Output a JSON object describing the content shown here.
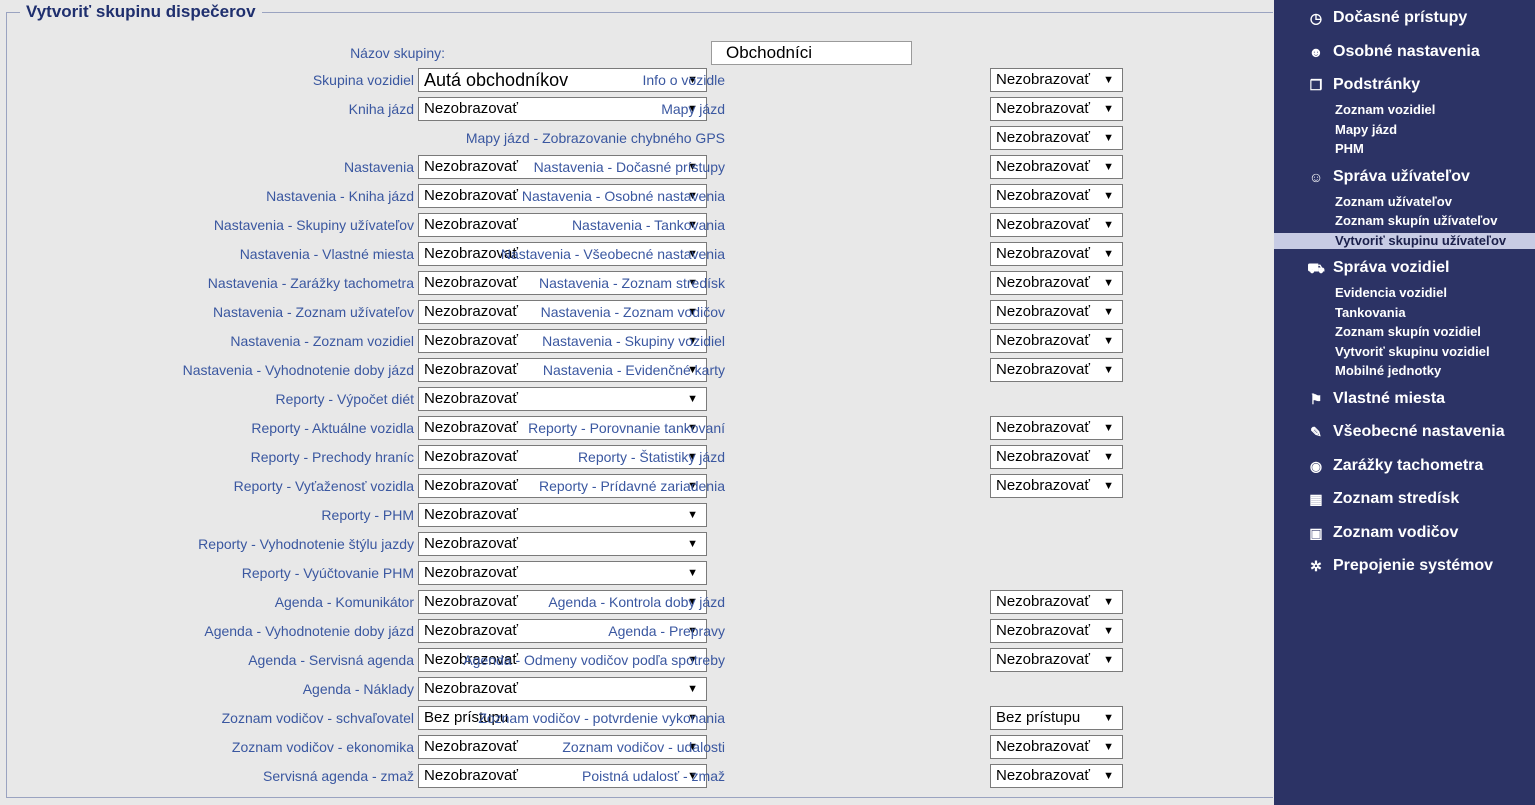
{
  "form": {
    "legend": "Vytvoriť skupinu dispečerov",
    "name_label": "Názov skupiny:",
    "name_value": "Obchodníci"
  },
  "rows_left": [
    {
      "label": "Skupina vozidiel",
      "value": "Autá obchodníkov"
    },
    {
      "label": "Kniha jázd",
      "value": "Nezobrazovať"
    },
    null,
    {
      "label": "Nastavenia",
      "value": "Nezobrazovať"
    },
    {
      "label": "Nastavenia - Kniha jázd",
      "value": "Nezobrazovať"
    },
    {
      "label": "Nastavenia - Skupiny užívateľov",
      "value": "Nezobrazovať"
    },
    {
      "label": "Nastavenia - Vlastné miesta",
      "value": "Nezobrazovať"
    },
    {
      "label": "Nastavenia - Zarážky tachometra",
      "value": "Nezobrazovať"
    },
    {
      "label": "Nastavenia - Zoznam užívateľov",
      "value": "Nezobrazovať"
    },
    {
      "label": "Nastavenia - Zoznam vozidiel",
      "value": "Nezobrazovať"
    },
    {
      "label": "Nastavenia - Vyhodnotenie doby jázd",
      "value": "Nezobrazovať"
    },
    {
      "label": "Reporty - Výpočet diét",
      "value": "Nezobrazovať"
    },
    {
      "label": "Reporty - Aktuálne vozidla",
      "value": "Nezobrazovať"
    },
    {
      "label": "Reporty - Prechody hraníc",
      "value": "Nezobrazovať"
    },
    {
      "label": "Reporty - Vyťaženosť vozidla",
      "value": "Nezobrazovať"
    },
    {
      "label": "Reporty - PHM",
      "value": "Nezobrazovať"
    },
    {
      "label": "Reporty - Vyhodnotenie štýlu jazdy",
      "value": "Nezobrazovať"
    },
    {
      "label": "Reporty - Vyúčtovanie PHM",
      "value": "Nezobrazovať"
    },
    {
      "label": "Agenda - Komunikátor",
      "value": "Nezobrazovať"
    },
    {
      "label": "Agenda - Vyhodnotenie doby jázd",
      "value": "Nezobrazovať"
    },
    {
      "label": "Agenda - Servisná agenda",
      "value": "Nezobrazovať"
    },
    {
      "label": "Agenda - Náklady",
      "value": "Nezobrazovať"
    },
    {
      "label": "Zoznam vodičov - schvaľovatel",
      "value": "Bez prístupu"
    },
    {
      "label": "Zoznam vodičov - ekonomika",
      "value": "Nezobrazovať"
    },
    {
      "label": "Servisná agenda - zmaž",
      "value": "Nezobrazovať"
    }
  ],
  "rows_right": [
    {
      "label": "Info o vozidle",
      "value": "Nezobrazovať"
    },
    {
      "label": "Mapy jázd",
      "value": "Nezobrazovať"
    },
    {
      "label": "Mapy jázd - Zobrazovanie chybného GPS",
      "value": "Nezobrazovať"
    },
    {
      "label": "Nastavenia - Dočasné prístupy",
      "value": "Nezobrazovať"
    },
    {
      "label": "Nastavenia - Osobné nastavenia",
      "value": "Nezobrazovať"
    },
    {
      "label": "Nastavenia - Tankovania",
      "value": "Nezobrazovať"
    },
    {
      "label": "Nastavenia - Všeobecné nastavenia",
      "value": "Nezobrazovať"
    },
    {
      "label": "Nastavenia - Zoznam stredísk",
      "value": "Nezobrazovať"
    },
    {
      "label": "Nastavenia - Zoznam vodičov",
      "value": "Nezobrazovať"
    },
    {
      "label": "Nastavenia - Skupiny vozidiel",
      "value": "Nezobrazovať"
    },
    {
      "label": "Nastavenia - Evidenčné karty",
      "value": "Nezobrazovať"
    },
    null,
    {
      "label": "Reporty - Porovnanie tankovaní",
      "value": "Nezobrazovať"
    },
    {
      "label": "Reporty - Štatistiky jázd",
      "value": "Nezobrazovať"
    },
    {
      "label": "Reporty - Prídavné zariadenia",
      "value": "Nezobrazovať"
    },
    null,
    null,
    null,
    {
      "label": "Agenda - Kontrola doby jázd",
      "value": "Nezobrazovať"
    },
    {
      "label": "Agenda - Prepravy",
      "value": "Nezobrazovať"
    },
    {
      "label": "Agenda - Odmeny vodičov podľa spotreby",
      "value": "Nezobrazovať"
    },
    null,
    {
      "label": "Zoznam vodičov - potvrdenie vykonania",
      "value": "Bez prístupu"
    },
    {
      "label": "Zoznam vodičov - udalosti",
      "value": "Nezobrazovať"
    },
    {
      "label": "Poistná udalosť - zmaž",
      "value": "Nezobrazovať"
    }
  ],
  "sidebar": [
    {
      "label": "Dočasné prístupy",
      "icon": "clock-icon",
      "glyph": "◷"
    },
    {
      "label": "Osobné nastavenia",
      "icon": "user-icon",
      "glyph": "☻"
    },
    {
      "label": "Podstránky",
      "icon": "pages-icon",
      "glyph": "❐",
      "children": [
        "Zoznam vozidiel",
        "Mapy jázd",
        "PHM"
      ]
    },
    {
      "label": "Správa užívateľov",
      "icon": "users-icon",
      "glyph": "☺",
      "children": [
        "Zoznam užívateľov",
        "Zoznam skupín užívateľov",
        "Vytvoriť skupinu užívateľov"
      ]
    },
    {
      "label": "Správa vozidiel",
      "icon": "car-icon",
      "glyph": "⛟",
      "children": [
        "Evidencia vozidiel",
        "Tankovania",
        "Zoznam skupín vozidiel",
        "Vytvoriť skupinu vozidiel",
        "Mobilné jednotky"
      ]
    },
    {
      "label": "Vlastné miesta",
      "icon": "flag-icon",
      "glyph": "⚑"
    },
    {
      "label": "Všeobecné nastavenia",
      "icon": "wrench-icon",
      "glyph": "✎"
    },
    {
      "label": "Zarážky tachometra",
      "icon": "gauge-icon",
      "glyph": "◉"
    },
    {
      "label": "Zoznam stredísk",
      "icon": "table-icon",
      "glyph": "▦"
    },
    {
      "label": "Zoznam vodičov",
      "icon": "driver-card-icon",
      "glyph": "▣"
    },
    {
      "label": "Prepojenie systémov",
      "icon": "connect-icon",
      "glyph": "✲"
    }
  ],
  "sidebar_active": "Vytvoriť skupinu užívateľov",
  "colors": {
    "sidebar_bg": "#2c3365",
    "active_bg": "#c7cbe4",
    "label_text": "#3a57a0",
    "legend_text": "#1f2f6e"
  }
}
